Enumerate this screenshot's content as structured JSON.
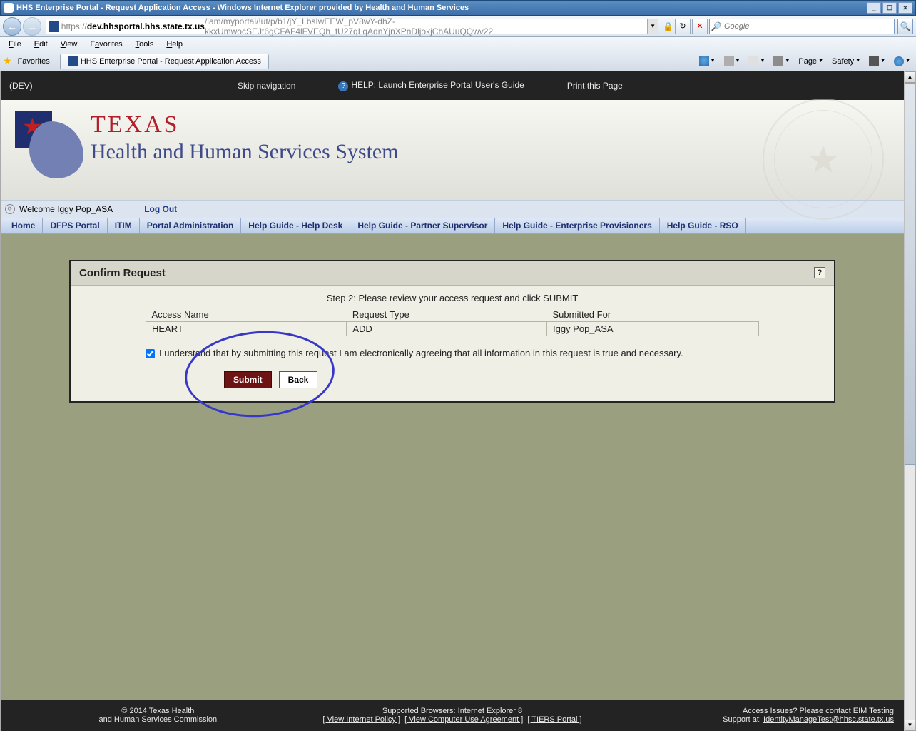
{
  "window": {
    "title": "HHS Enterprise Portal - Request Application Access - Windows Internet Explorer provided by Health and Human Services",
    "min": "_",
    "max": "❐",
    "restore": "☐",
    "close": "✕"
  },
  "nav": {
    "back": "←",
    "fwd": "→",
    "url_prefix": "https://",
    "url_host": "dev.hhsportal.hhs.state.tx.us",
    "url_path": "/iam/myportal/!ut/p/b1/jY_LbsIwEEW_pV8wY-dhZ-kkxUmwocSEJt6gCFAF4lFVEQh_fU27qLqAdnYjnXPnDljokjChAUuQQwv22",
    "lock": "🔒",
    "refresh": "↻",
    "stop": "✕",
    "search_placeholder": "Google",
    "search_icon": "🔍"
  },
  "menu": [
    "File",
    "Edit",
    "View",
    "Favorites",
    "Tools",
    "Help"
  ],
  "tabstrip": {
    "favorites": "Favorites",
    "tab_title": "HHS Enterprise Portal - Request Application Access",
    "cmds": {
      "page": "Page",
      "safety": "Safety"
    }
  },
  "blackbar": {
    "env": "(DEV)",
    "skip": "Skip navigation",
    "help": "HELP: Launch Enterprise Portal User's Guide",
    "print": "Print this Page"
  },
  "logo": {
    "t1": "TEXAS",
    "t2": "Health and Human Services System"
  },
  "welcome": {
    "text": "Welcome Iggy Pop_ASA",
    "logout": "Log Out"
  },
  "navtabs": [
    "Home",
    "DFPS Portal",
    "ITIM",
    "Portal Administration",
    "Help Guide - Help Desk",
    "Help Guide - Partner Supervisor",
    "Help Guide - Enterprise Provisioners",
    "Help Guide - RSO"
  ],
  "panel": {
    "title": "Confirm Request",
    "step": "Step 2: Please review your access request and click SUBMIT",
    "headers": {
      "name": "Access Name",
      "type": "Request Type",
      "for": "Submitted For"
    },
    "row": {
      "name": "HEART",
      "type": "ADD",
      "for": "Iggy Pop_ASA"
    },
    "agree": "I understand that by submitting this request I am electronically agreeing that all information in this request is true and necessary.",
    "submit": "Submit",
    "back": "Back",
    "help": "?"
  },
  "footer": {
    "copyright1": "© 2014 Texas Health",
    "copyright2": "and Human Services Commission",
    "browsers": "Supported Browsers: Internet Explorer 8",
    "link1": "[ View Internet Policy ]",
    "link2": "[ View Computer Use Agreement ]",
    "link3": "[ TIERS Portal ]",
    "issues": "Access Issues? Please contact EIM Testing",
    "support_pre": "Support at: ",
    "support_email": "IdentityManageTest@hhsc.state.tx.us"
  }
}
